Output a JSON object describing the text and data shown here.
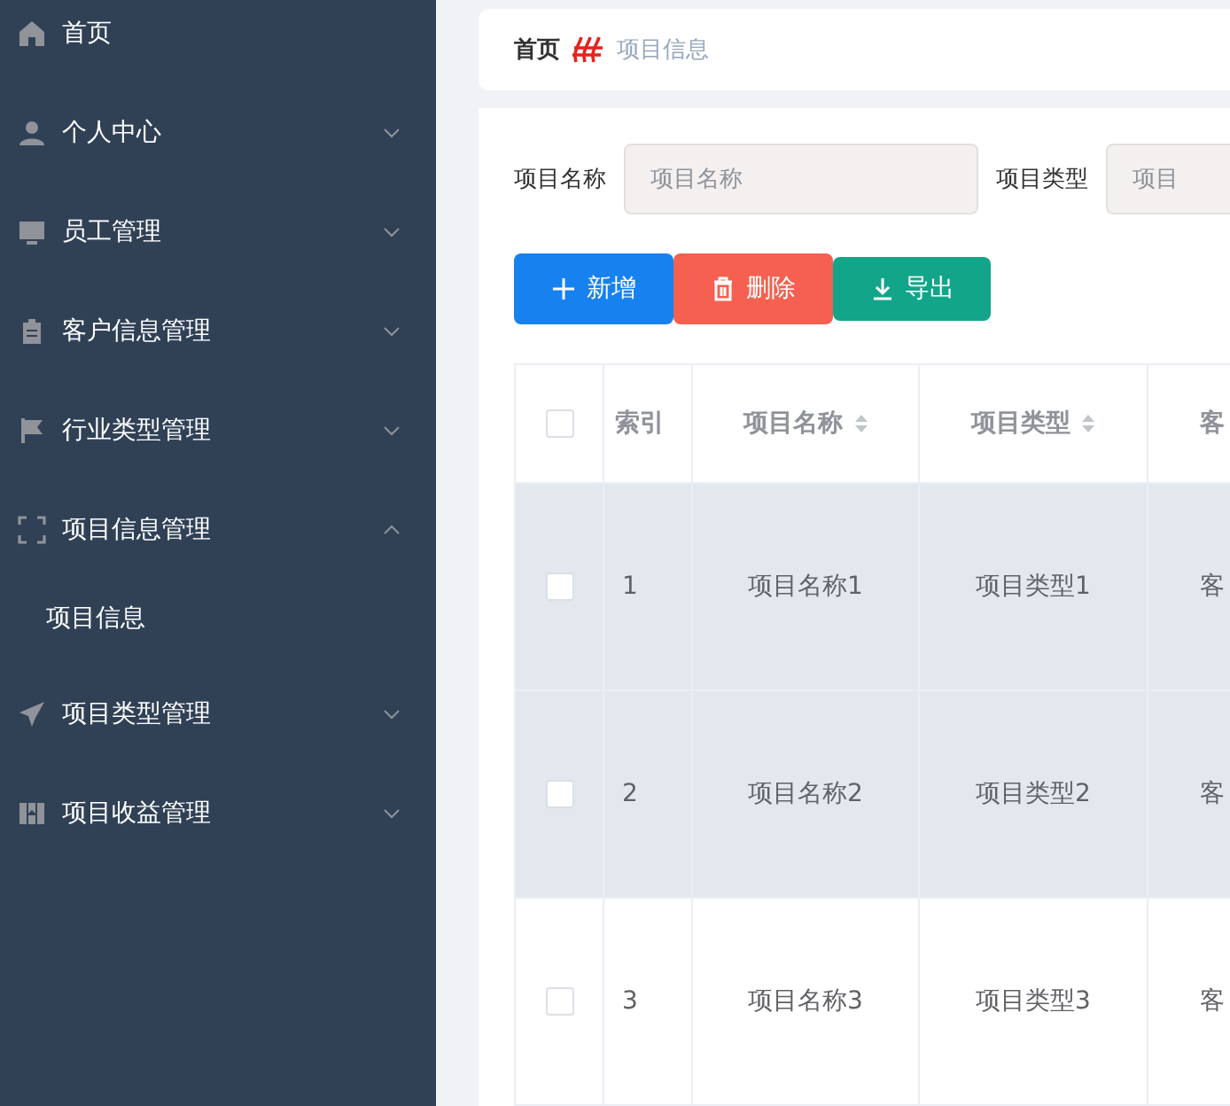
{
  "sidebar": {
    "items": [
      {
        "label": "首页"
      },
      {
        "label": "个人中心",
        "expanded": false
      },
      {
        "label": "员工管理",
        "expanded": false
      },
      {
        "label": "客户信息管理",
        "expanded": false
      },
      {
        "label": "行业类型管理",
        "expanded": false
      },
      {
        "label": "项目信息管理",
        "expanded": true,
        "children": [
          {
            "label": "项目信息"
          }
        ]
      },
      {
        "label": "项目类型管理",
        "expanded": false
      },
      {
        "label": "项目收益管理",
        "expanded": false
      }
    ]
  },
  "breadcrumb": [
    "首页",
    "项目信息"
  ],
  "search": {
    "fields": [
      {
        "label": "项目名称",
        "placeholder": "项目名称"
      },
      {
        "label": "项目类型",
        "placeholder": "项目"
      }
    ]
  },
  "buttons": [
    {
      "label": "新增",
      "kind": "add"
    },
    {
      "label": "删除",
      "kind": "delete"
    },
    {
      "label": "导出",
      "kind": "export"
    }
  ],
  "table": {
    "all_checked": false,
    "columns": [
      {
        "label": "索引",
        "sortable": false
      },
      {
        "label": "项目名称",
        "sortable": true
      },
      {
        "label": "项目类型",
        "sortable": true
      },
      {
        "label": "客",
        "sortable": false
      }
    ],
    "rows": [
      {
        "checked": false,
        "striped": true,
        "cells": [
          "1",
          "项目名称1",
          "项目类型1",
          "客"
        ]
      },
      {
        "checked": false,
        "striped": true,
        "cells": [
          "2",
          "项目名称2",
          "项目类型2",
          "客"
        ]
      },
      {
        "checked": false,
        "striped": false,
        "cells": [
          "3",
          "项目名称3",
          "项目类型3",
          "客"
        ]
      }
    ]
  }
}
